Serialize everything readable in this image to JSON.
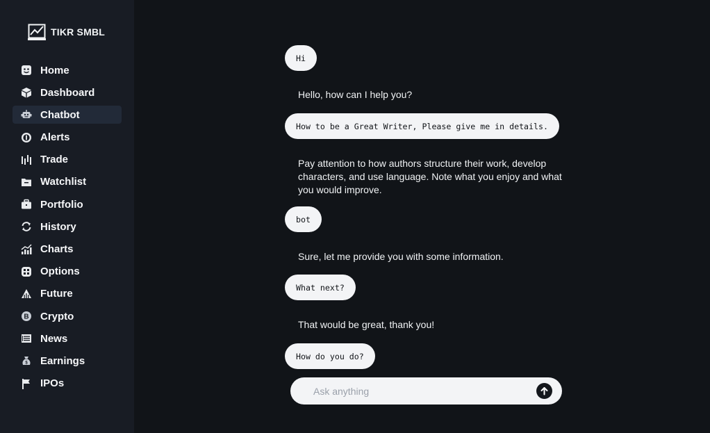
{
  "brand": {
    "name": "TIKR SMBL"
  },
  "sidebar": {
    "items": [
      {
        "label": "Home",
        "icon": "smiley-face-icon",
        "active": false
      },
      {
        "label": "Dashboard",
        "icon": "cube-icon",
        "active": false
      },
      {
        "label": "Chatbot",
        "icon": "robot-icon",
        "active": true
      },
      {
        "label": "Alerts",
        "icon": "alert-circle-icon",
        "active": false
      },
      {
        "label": "Trade",
        "icon": "candlestick-icon",
        "active": false
      },
      {
        "label": "Watchlist",
        "icon": "folder-icon",
        "active": false
      },
      {
        "label": "Portfolio",
        "icon": "briefcase-icon",
        "active": false
      },
      {
        "label": "History",
        "icon": "refresh-arrows-icon",
        "active": false
      },
      {
        "label": "Charts",
        "icon": "bar-chart-trend-icon",
        "active": false
      },
      {
        "label": "Options",
        "icon": "options-grid-icon",
        "active": false
      },
      {
        "label": "Future",
        "icon": "future-arrow-icon",
        "active": false
      },
      {
        "label": "Crypto",
        "icon": "bitcoin-icon",
        "active": false
      },
      {
        "label": "News",
        "icon": "newspaper-icon",
        "active": false
      },
      {
        "label": "Earnings",
        "icon": "money-bag-icon",
        "active": false
      },
      {
        "label": "IPOs",
        "icon": "flag-icon",
        "active": false
      }
    ]
  },
  "chat": {
    "messages": [
      {
        "role": "user",
        "text": "Hi"
      },
      {
        "role": "bot",
        "text": "Hello, how can I help you?"
      },
      {
        "role": "user",
        "text": "How to be a Great Writer, Please give me in details."
      },
      {
        "role": "bot",
        "text": "Pay attention to how authors structure their work, develop characters, and use language. Note what you enjoy and what you would improve."
      },
      {
        "role": "user",
        "text": "bot"
      },
      {
        "role": "bot",
        "text": "Sure, let me provide you with some information."
      },
      {
        "role": "user",
        "text": "What next?"
      },
      {
        "role": "bot",
        "text": "That would be great, thank you!"
      },
      {
        "role": "user",
        "text": "How do you do?"
      }
    ]
  },
  "composer": {
    "placeholder": "Ask anything",
    "value": "",
    "send_icon": "arrow-up-icon"
  },
  "colors": {
    "background": "#111418",
    "sidebar": "#181c24",
    "active_item": "#222a38",
    "bubble": "#f3f4f6"
  }
}
